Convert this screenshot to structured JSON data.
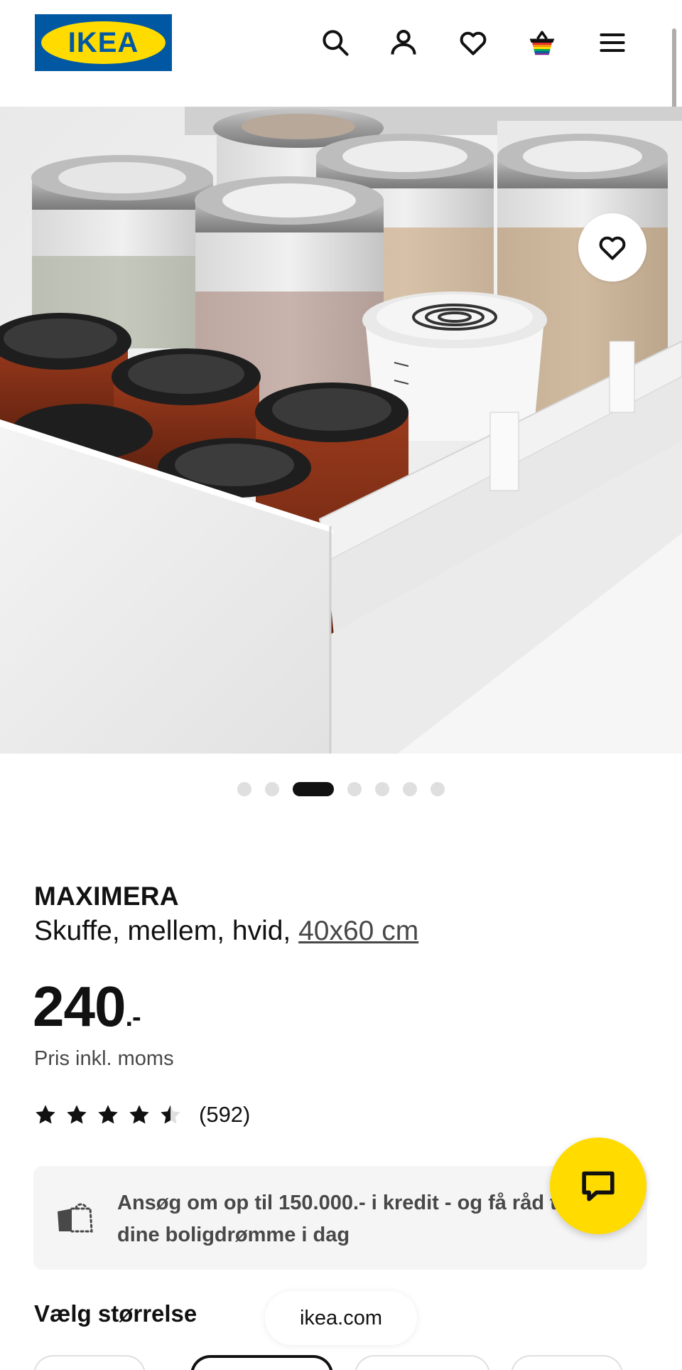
{
  "header": {
    "logo_text": "IKEA",
    "icons": [
      "search-icon",
      "account-icon",
      "heart-icon",
      "basket-icon",
      "menu-icon"
    ]
  },
  "gallery": {
    "total_images": 7,
    "active_index": 2,
    "favorite_icon": "heart-icon"
  },
  "product": {
    "name": "MAXIMERA",
    "description": "Skuffe, mellem, hvid, ",
    "size_link": "40x60 cm",
    "price_integer": "240",
    "price_suffix": ".-",
    "price_note": "Pris inkl. moms",
    "rating_value": 4.5,
    "rating_count": "(592)"
  },
  "credit": {
    "text": "Ansøg om op til 150.000.- i kredit - og få råd til dine boligdrømme i dag",
    "icon": "credit-card-icon"
  },
  "chat": {
    "icon": "chat-icon"
  },
  "size_section": {
    "title": "Vælg størrelse"
  },
  "browser": {
    "url": "ikea.com"
  },
  "colors": {
    "ikea_blue": "#0058a3",
    "ikea_yellow": "#ffdb00"
  }
}
